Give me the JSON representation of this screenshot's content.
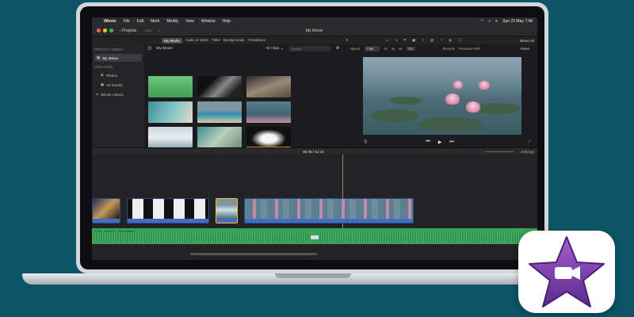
{
  "menubar": {
    "app": "iMovie",
    "items": [
      "File",
      "Edit",
      "Mark",
      "Modify",
      "View",
      "Window",
      "Help"
    ],
    "clock": "Sun 22 May 7:48"
  },
  "toolbar": {
    "projects_label": "‹ Projects",
    "title": "My Movie"
  },
  "tabs": [
    "My Media",
    "Audio & Video",
    "Titles",
    "Backgrounds",
    "Transitions"
  ],
  "viewer_top": {
    "reset_all": "Reset All"
  },
  "sidebar": {
    "header1": "PROJECT MEDIA",
    "project": "My Movie",
    "header2": "LIBRARIES",
    "items": [
      "Photos",
      "All Events"
    ],
    "library": "iMovie Library"
  },
  "browser": {
    "title": "My Movie",
    "filter": "All Clips ⌄",
    "search_placeholder": "Search"
  },
  "speed": {
    "label": "Speed:",
    "value": "Fast",
    "options": [
      "2x",
      "4x",
      "8x",
      "20x"
    ],
    "reverse": "Reverse",
    "preserve": "Preserve Pitch",
    "reset": "Reset"
  },
  "timeline": {
    "time": "00:45 / 01:10",
    "settings": "Settings",
    "audio_label": "1.9m – Music 2 - Wild Water"
  },
  "colors": {
    "background": "#0b5566",
    "clip_strip": "#3e6fc4",
    "audio_track": "#3aa35a",
    "icon_star": "#7b3fa8"
  }
}
